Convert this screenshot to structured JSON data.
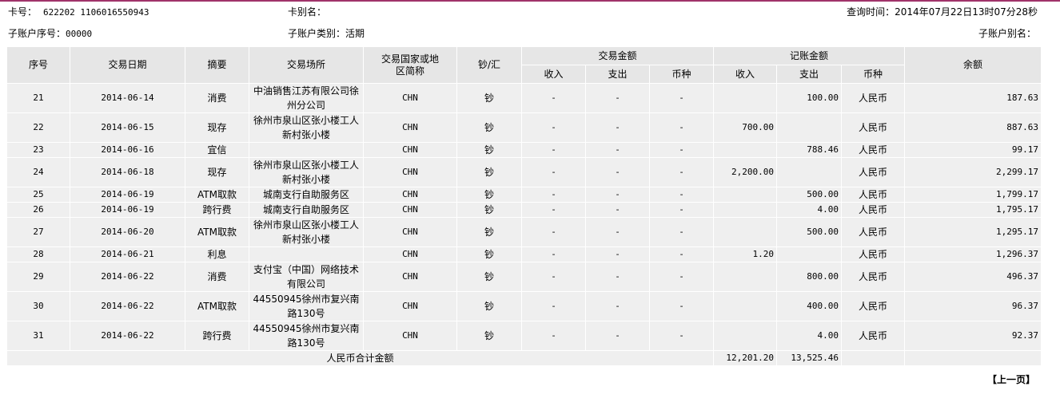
{
  "header": {
    "card_label": "卡号：",
    "card_no": "622202 1106016550943",
    "alias_label": "卡别名：",
    "alias_value": "",
    "query_time": "查询时间：2014年07月22日13时07分28秒",
    "sub_no_label": "子账户序号：",
    "sub_no": "00000",
    "sub_type_label": "子账户类别：",
    "sub_type": "活期",
    "sub_alias_label": "子账户别名："
  },
  "table": {
    "h_seq": "序号",
    "h_date": "交易日期",
    "h_summary": "摘要",
    "h_place": "交易场所",
    "h_country": "交易国家或地区简称",
    "h_cash": "钞/汇",
    "h_tx_amount": "交易金额",
    "h_book_amount": "记账金额",
    "h_balance": "余额",
    "h_income": "收入",
    "h_expense": "支出",
    "h_currency": "币种",
    "rows": [
      {
        "seq": "21",
        "date": "2014-06-14",
        "summary": "消费",
        "place": "中油销售江苏有限公司徐州分公司",
        "country": "CHN",
        "cash": "钞",
        "tx_in": "-",
        "tx_out": "-",
        "tx_cur": "-",
        "bk_in": "",
        "bk_out": "100.00",
        "bk_cur": "人民币",
        "balance": "187.63"
      },
      {
        "seq": "22",
        "date": "2014-06-15",
        "summary": "现存",
        "place": "徐州市泉山区张小楼工人新村张小楼",
        "country": "CHN",
        "cash": "钞",
        "tx_in": "-",
        "tx_out": "-",
        "tx_cur": "-",
        "bk_in": "700.00",
        "bk_out": "",
        "bk_cur": "人民币",
        "balance": "887.63"
      },
      {
        "seq": "23",
        "date": "2014-06-16",
        "summary": "宜信",
        "place": "",
        "country": "CHN",
        "cash": "钞",
        "tx_in": "-",
        "tx_out": "-",
        "tx_cur": "-",
        "bk_in": "",
        "bk_out": "788.46",
        "bk_cur": "人民币",
        "balance": "99.17"
      },
      {
        "seq": "24",
        "date": "2014-06-18",
        "summary": "现存",
        "place": "徐州市泉山区张小楼工人新村张小楼",
        "country": "CHN",
        "cash": "钞",
        "tx_in": "-",
        "tx_out": "-",
        "tx_cur": "-",
        "bk_in": "2,200.00",
        "bk_out": "",
        "bk_cur": "人民币",
        "balance": "2,299.17"
      },
      {
        "seq": "25",
        "date": "2014-06-19",
        "summary": "ATM取款",
        "place": "城南支行自助服务区",
        "country": "CHN",
        "cash": "钞",
        "tx_in": "-",
        "tx_out": "-",
        "tx_cur": "-",
        "bk_in": "",
        "bk_out": "500.00",
        "bk_cur": "人民币",
        "balance": "1,799.17"
      },
      {
        "seq": "26",
        "date": "2014-06-19",
        "summary": "跨行费",
        "place": "城南支行自助服务区",
        "country": "CHN",
        "cash": "钞",
        "tx_in": "-",
        "tx_out": "-",
        "tx_cur": "-",
        "bk_in": "",
        "bk_out": "4.00",
        "bk_cur": "人民币",
        "balance": "1,795.17"
      },
      {
        "seq": "27",
        "date": "2014-06-20",
        "summary": "ATM取款",
        "place": "徐州市泉山区张小楼工人新村张小楼",
        "country": "CHN",
        "cash": "钞",
        "tx_in": "-",
        "tx_out": "-",
        "tx_cur": "-",
        "bk_in": "",
        "bk_out": "500.00",
        "bk_cur": "人民币",
        "balance": "1,295.17"
      },
      {
        "seq": "28",
        "date": "2014-06-21",
        "summary": "利息",
        "place": "",
        "country": "CHN",
        "cash": "钞",
        "tx_in": "-",
        "tx_out": "-",
        "tx_cur": "-",
        "bk_in": "1.20",
        "bk_out": "",
        "bk_cur": "人民币",
        "balance": "1,296.37"
      },
      {
        "seq": "29",
        "date": "2014-06-22",
        "summary": "消费",
        "place": "支付宝（中国）网络技术有限公司",
        "country": "CHN",
        "cash": "钞",
        "tx_in": "-",
        "tx_out": "-",
        "tx_cur": "-",
        "bk_in": "",
        "bk_out": "800.00",
        "bk_cur": "人民币",
        "balance": "496.37"
      },
      {
        "seq": "30",
        "date": "2014-06-22",
        "summary": "ATM取款",
        "place": "44550945徐州市复兴南路130号",
        "country": "CHN",
        "cash": "钞",
        "tx_in": "-",
        "tx_out": "-",
        "tx_cur": "-",
        "bk_in": "",
        "bk_out": "400.00",
        "bk_cur": "人民币",
        "balance": "96.37"
      },
      {
        "seq": "31",
        "date": "2014-06-22",
        "summary": "跨行费",
        "place": "44550945徐州市复兴南路130号",
        "country": "CHN",
        "cash": "钞",
        "tx_in": "-",
        "tx_out": "-",
        "tx_cur": "-",
        "bk_in": "",
        "bk_out": "4.00",
        "bk_cur": "人民币",
        "balance": "92.37"
      }
    ],
    "total_label": "人民币合计金额",
    "total_in": "12,201.20",
    "total_out": "13,525.46"
  },
  "pager": {
    "prev_label": "【上一页】"
  },
  "colors": {
    "accent_line": "#a0336a",
    "header_bg": "#e6e6e6",
    "row_bg": "#efefef"
  }
}
